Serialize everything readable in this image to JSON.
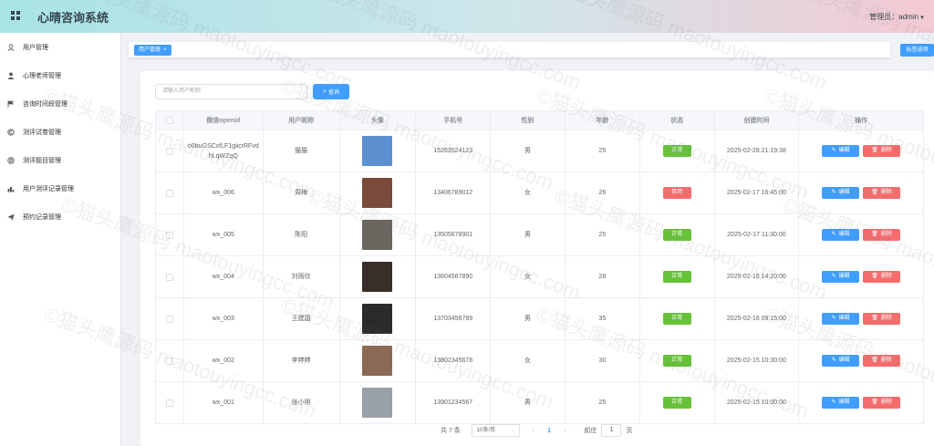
{
  "header": {
    "title": "心晴咨询系统",
    "user_label": "管理员：",
    "user_name": "admin"
  },
  "sidebar": {
    "items": [
      {
        "label": "用户管理",
        "icon": "user-icon"
      },
      {
        "label": "心理老师管理",
        "icon": "person-icon"
      },
      {
        "label": "咨询时间段管理",
        "icon": "flag-icon"
      },
      {
        "label": "测评试卷管理",
        "icon": "c-icon"
      },
      {
        "label": "测评题目管理",
        "icon": "target-icon"
      },
      {
        "label": "用户测评记录管理",
        "icon": "chart-icon"
      },
      {
        "label": "预约记录管理",
        "icon": "plane-icon"
      }
    ]
  },
  "tabs": {
    "active": "用户管理",
    "close": "×",
    "right_button": "标签选项"
  },
  "search": {
    "placeholder": "请输入用户昵称",
    "button": "查询"
  },
  "table": {
    "columns": [
      "微信openid",
      "用户昵称",
      "头像",
      "手机号",
      "性别",
      "年龄",
      "状态",
      "创建时间",
      "操作"
    ],
    "edit_label": "编辑",
    "delete_label": "删除",
    "rows": [
      {
        "openid": "o0buGSCxfLF1giicrRFvdhLqWZqQ",
        "nickname": "猫猫",
        "phone": "15263524123",
        "gender": "男",
        "age": "25",
        "status": "正常",
        "status_color": "#67c23a",
        "created": "2025-02-28 21:19:38",
        "avatar_color": "#5b8fd0"
      },
      {
        "openid": "wx_006",
        "nickname": "周梅",
        "phone": "13406789012",
        "gender": "女",
        "age": "26",
        "status": "禁用",
        "status_color": "#f56c6c",
        "created": "2025-02-17 16:45:00",
        "avatar_color": "#7a4a3a"
      },
      {
        "openid": "wx_005",
        "nickname": "陈阳",
        "phone": "13505678901",
        "gender": "男",
        "age": "25",
        "status": "正常",
        "status_color": "#67c23a",
        "created": "2025-02-17 11:30:00",
        "avatar_color": "#6b6560"
      },
      {
        "openid": "wx_004",
        "nickname": "刘雨欣",
        "phone": "13604567890",
        "gender": "女",
        "age": "28",
        "status": "正常",
        "status_color": "#67c23a",
        "created": "2025-02-16 14:20:00",
        "avatar_color": "#3a2e2a"
      },
      {
        "openid": "wx_003",
        "nickname": "王建国",
        "phone": "13703456789",
        "gender": "男",
        "age": "35",
        "status": "正常",
        "status_color": "#67c23a",
        "created": "2025-02-16 09:15:00",
        "avatar_color": "#2b2b2b"
      },
      {
        "openid": "wx_002",
        "nickname": "李婷婷",
        "phone": "13802345678",
        "gender": "女",
        "age": "30",
        "status": "正常",
        "status_color": "#67c23a",
        "created": "2025-02-15 10:30:00",
        "avatar_color": "#8a6a55"
      },
      {
        "openid": "wx_001",
        "nickname": "张小明",
        "phone": "13901234567",
        "gender": "男",
        "age": "25",
        "status": "正常",
        "status_color": "#67c23a",
        "created": "2025-02-15 10:00:00",
        "avatar_color": "#9aa0a8"
      }
    ]
  },
  "pagination": {
    "total": "共 7 条",
    "page_size": "10条/页",
    "prev": "‹",
    "page": "1",
    "next": "›",
    "goto_label": "前往",
    "goto_value": "1",
    "page_unit": "页"
  },
  "watermark": "©猫头鹰源码 maotouyingcc.com",
  "colors": {
    "primary": "#409eff",
    "success": "#67c23a",
    "danger": "#f56c6c"
  }
}
